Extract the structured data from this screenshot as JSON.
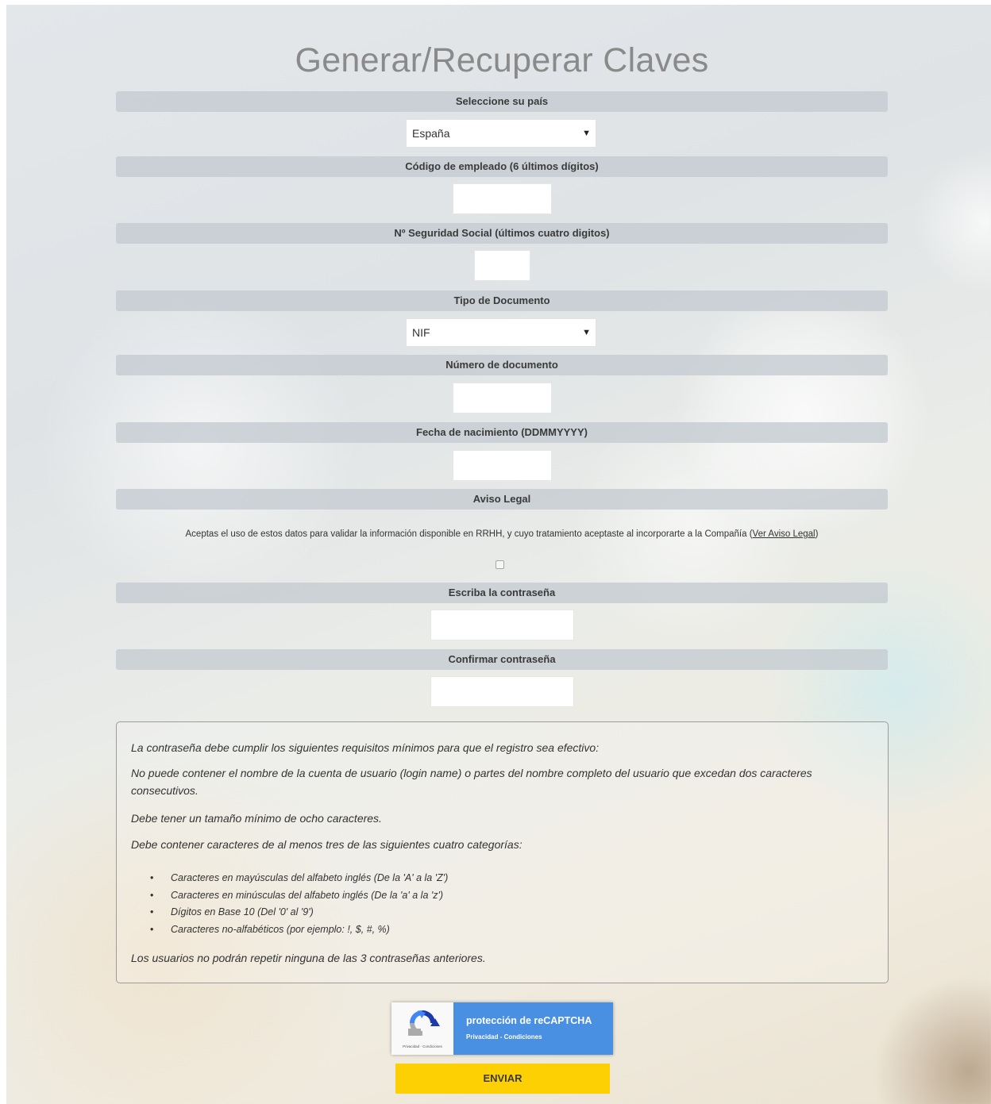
{
  "page": {
    "title": "Generar/Recuperar Claves"
  },
  "form": {
    "country": {
      "label": "Seleccione su país",
      "selected": "España"
    },
    "employee_code": {
      "label": "Código de empleado (6 últimos dígitos)",
      "value": ""
    },
    "social_security": {
      "label": "Nº Seguridad Social (últimos cuatro digitos)",
      "value": ""
    },
    "document_type": {
      "label": "Tipo de Documento",
      "selected": "NIF"
    },
    "document_number": {
      "label": "Número de documento",
      "value": ""
    },
    "birth_date": {
      "label": "Fecha de nacimiento (DDMMYYYY)",
      "value": ""
    },
    "legal": {
      "label": "Aviso Legal",
      "text": "Aceptas el uso de estos datos para validar la información disponible en RRHH, y cuyo tratamiento aceptaste al incorporarte a la Compañía (",
      "link": "Ver Aviso Legal",
      "text_end": ")",
      "checked": false
    },
    "password": {
      "label": "Escriba la contraseña",
      "value": ""
    },
    "confirm_password": {
      "label": "Confirmar contraseña",
      "value": ""
    }
  },
  "requirements": {
    "intro": "La contraseña debe cumplir los siguientes requisitos mínimos para que el registro sea efectivo:",
    "rule1": "No puede contener el nombre de la cuenta de usuario (login name) o partes del nombre completo del usuario que excedan dos caracteres consecutivos.",
    "rule2": "Debe tener un tamaño mínimo de ocho caracteres.",
    "rule3": "Debe contener caracteres de al menos tres de las siguientes cuatro categorías:",
    "categories": [
      "Caracteres en mayúsculas del alfabeto inglés (De la 'A' a la 'Z')",
      "Caracteres en minúsculas del alfabeto inglés (De la 'a' a la 'z')",
      "Dígitos en Base 10 (Del '0' al '9')",
      "Caracteres no-alfabéticos (por ejemplo: !, $, #, %)"
    ],
    "footer": "Los usuarios no podrán repetir ninguna de las 3 contraseñas anteriores."
  },
  "recaptcha": {
    "title": "protección de reCAPTCHA",
    "links": "Privacidad - Condiciones",
    "small_links": "Privacidad - Condiciones"
  },
  "submit": {
    "label": "ENVIAR"
  },
  "colors": {
    "submit_bg": "#fdd003",
    "recaptcha_bg": "#4a90e2",
    "bar_bg": "#c4cbd1"
  }
}
